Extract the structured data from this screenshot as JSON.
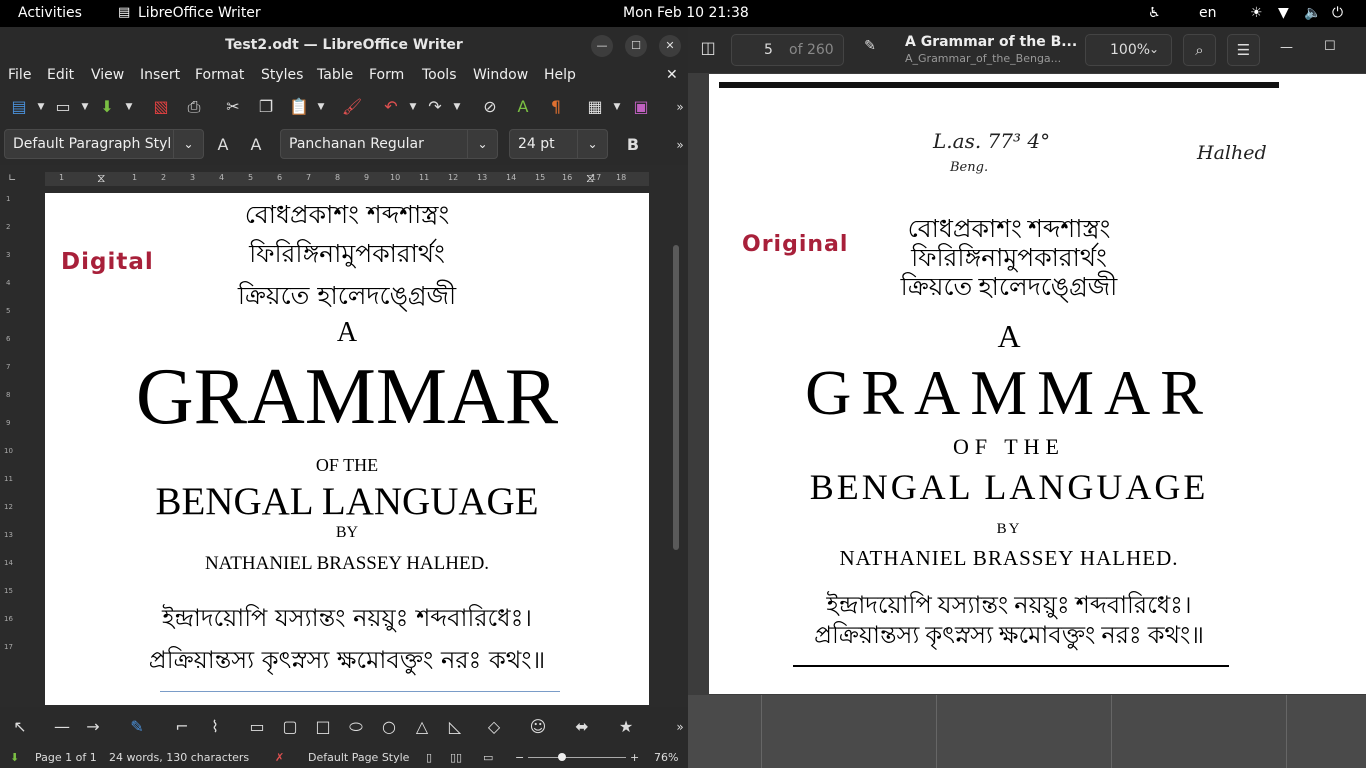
{
  "system": {
    "activities": "Activities",
    "app_name": "LibreOffice Writer",
    "datetime": "Mon Feb 10  21:38",
    "lang": "en"
  },
  "writer": {
    "title": "Test2.odt — LibreOffice Writer",
    "menu": [
      "File",
      "Edit",
      "View",
      "Insert",
      "Format",
      "Styles",
      "Table",
      "Form",
      "Tools",
      "Window",
      "Help"
    ],
    "paragraph_style": "Default Paragraph Styl",
    "font_name": "Panchanan Regular",
    "font_size": "24 pt",
    "ruler_ticks": [
      "1",
      "1",
      "2",
      "3",
      "4",
      "5",
      "6",
      "7",
      "8",
      "9",
      "10",
      "11",
      "12",
      "13",
      "14",
      "15",
      "16",
      "17",
      "18"
    ],
    "vruler_ticks": [
      "1",
      "2",
      "3",
      "4",
      "5",
      "6",
      "7",
      "8",
      "9",
      "10",
      "11",
      "12",
      "13",
      "14",
      "15",
      "16",
      "17"
    ],
    "page": {
      "label": "Digital",
      "bengali_line1": "বোধপ্রকাশং শব্দশাস্ত্রং",
      "bengali_line2": "ফিরিঙ্গিনামুপকারার্থং",
      "bengali_line3": "ক্রিয়তে হালেদঙ্গ্রেজী",
      "a": "A",
      "grammar": "GRAMMAR",
      "of_the": "OF THE",
      "bengal_language": "BENGAL  LANGUAGE",
      "by": "BY",
      "author": "NATHANIEL BRASSEY HALHED.",
      "verse1": "ইন্দ্রাদয়োপি যস্যান্তং নয়য়ুঃ শব্দবারিধেঃ।",
      "verse2": "প্রক্রিয়ান্তস্য কৃৎস্নস্য ক্ষমোবক্তুং নরঃ কথং॥"
    },
    "status": {
      "page": "Page 1 of 1",
      "words": "24 words, 130 characters",
      "page_style": "Default Page Style",
      "zoom": "76%"
    }
  },
  "viewer": {
    "page_current": "5",
    "page_total": "of 260",
    "doc_title": "A Grammar of the B...",
    "doc_subtitle": "A_Grammar_of_the_Benga...",
    "zoom": "100%",
    "page": {
      "label": "Original",
      "handwritten1": "L.as.  77³  4°",
      "handwritten2": "Beng.",
      "handwritten3": "Halhed",
      "bengali_line1": "বোধপ্রকাশং শব্দশাস্ত্রং",
      "bengali_line2": "ফিরিঙ্গিনামুপকারার্থং",
      "bengali_line3": "ক্রিয়তে হালেদঙ্গ্রেজী",
      "a": "A",
      "grammar": "GRAMMAR",
      "of_the": "OF THE",
      "bengal_language": "BENGAL LANGUAGE",
      "by": "BY",
      "author": "NATHANIEL BRASSEY HALHED.",
      "verse1": "ইন্দ্রাদয়োপি যস্যান্তং নয়য়ুঃ শব্দবারিধেঃ।",
      "verse2": "প্রক্রিয়ান্তস্য কৃৎস্নস্য ক্ষমোবক্তুং নরঃ কথং॥"
    }
  }
}
